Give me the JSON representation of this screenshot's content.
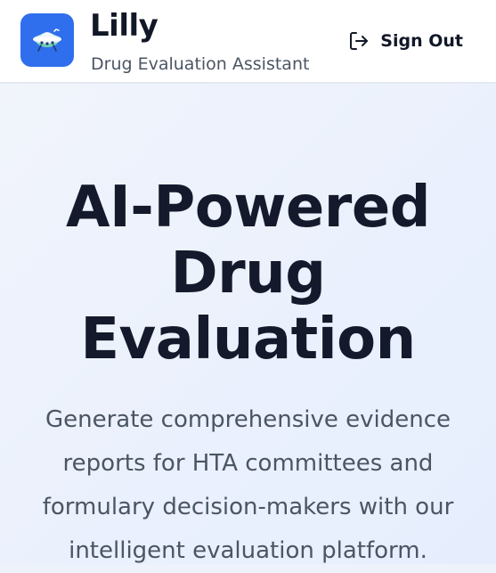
{
  "header": {
    "brand_name": "Lilly",
    "brand_subtitle": "Drug Evaluation Assistant",
    "logo_icon": "spaceship-icon",
    "signout_icon": "sign-out-icon",
    "signout_label": "Sign Out"
  },
  "hero": {
    "title_lines": [
      "AI-Powered",
      "Drug",
      "Evaluation"
    ],
    "description_lines": [
      "Generate comprehensive evidence",
      "reports for HTA committees and",
      "formulary decision-makers with our",
      "intelligent evaluation platform."
    ]
  },
  "colors": {
    "accent": "#2f6fed",
    "logo_glow": "#7ee0a8",
    "text_dark": "#141a2c",
    "text_muted": "#4b5563"
  }
}
